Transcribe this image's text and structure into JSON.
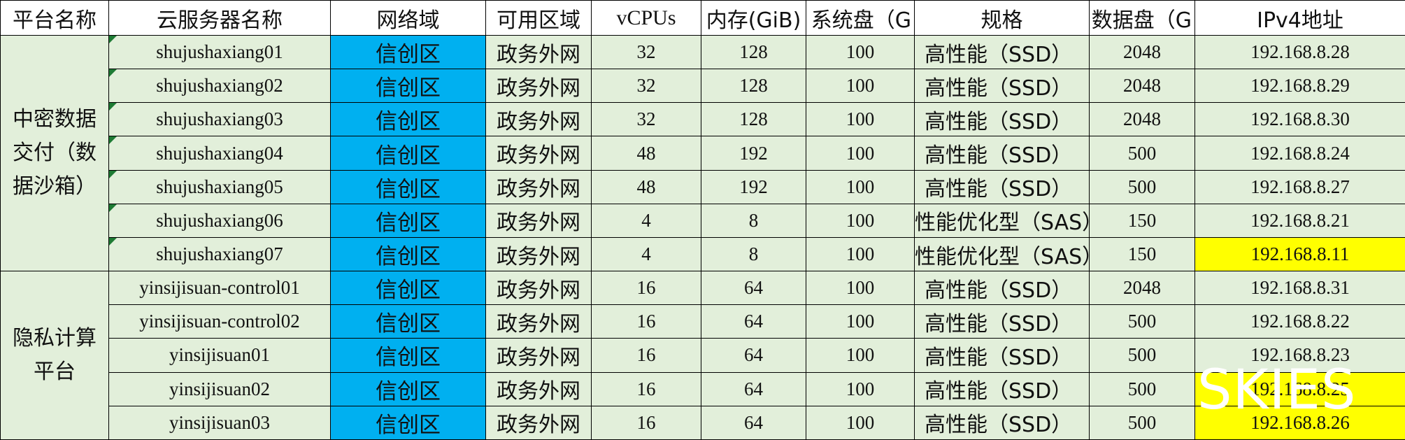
{
  "colors": {
    "grid_fill": "#e2efda",
    "header_fill": "#ffffff",
    "network_fill": "#00b0f0",
    "highlight_fill": "#ffff00",
    "flag_color": "#1e7b34",
    "border": "#000000"
  },
  "headers": [
    "平台名称",
    "云服务器名称",
    "网络域",
    "可用区域",
    "vCPUs",
    "内存(GiB)",
    "系统盘（G",
    "规格",
    "数据盘（G",
    "IPv4地址"
  ],
  "groups": [
    {
      "platform": "中密数据交付（数据沙箱）",
      "rows": [
        {
          "name": "shujushaxiang01",
          "network": "信创区",
          "zone": "政务外网",
          "vcpus": "32",
          "memory": "128",
          "sysdisk": "100",
          "spec": "高性能（SSD）",
          "datadisk": "2048",
          "ip": "192.168.8.28",
          "highlight": false,
          "flag": true
        },
        {
          "name": "shujushaxiang02",
          "network": "信创区",
          "zone": "政务外网",
          "vcpus": "32",
          "memory": "128",
          "sysdisk": "100",
          "spec": "高性能（SSD）",
          "datadisk": "2048",
          "ip": "192.168.8.29",
          "highlight": false,
          "flag": true
        },
        {
          "name": "shujushaxiang03",
          "network": "信创区",
          "zone": "政务外网",
          "vcpus": "32",
          "memory": "128",
          "sysdisk": "100",
          "spec": "高性能（SSD）",
          "datadisk": "2048",
          "ip": "192.168.8.30",
          "highlight": false,
          "flag": true
        },
        {
          "name": "shujushaxiang04",
          "network": "信创区",
          "zone": "政务外网",
          "vcpus": "48",
          "memory": "192",
          "sysdisk": "100",
          "spec": "高性能（SSD）",
          "datadisk": "500",
          "ip": "192.168.8.24",
          "highlight": false,
          "flag": true
        },
        {
          "name": "shujushaxiang05",
          "network": "信创区",
          "zone": "政务外网",
          "vcpus": "48",
          "memory": "192",
          "sysdisk": "100",
          "spec": "高性能（SSD）",
          "datadisk": "500",
          "ip": "192.168.8.27",
          "highlight": false,
          "flag": true
        },
        {
          "name": "shujushaxiang06",
          "network": "信创区",
          "zone": "政务外网",
          "vcpus": "4",
          "memory": "8",
          "sysdisk": "100",
          "spec": "性能优化型（SAS）",
          "datadisk": "150",
          "ip": "192.168.8.21",
          "highlight": false,
          "flag": true
        },
        {
          "name": "shujushaxiang07",
          "network": "信创区",
          "zone": "政务外网",
          "vcpus": "4",
          "memory": "8",
          "sysdisk": "100",
          "spec": "性能优化型（SAS）",
          "datadisk": "150",
          "ip": "192.168.8.11",
          "highlight": true,
          "flag": true
        }
      ]
    },
    {
      "platform": "隐私计算平台",
      "rows": [
        {
          "name": "yinsijisuan-control01",
          "network": "信创区",
          "zone": "政务外网",
          "vcpus": "16",
          "memory": "64",
          "sysdisk": "100",
          "spec": "高性能（SSD）",
          "datadisk": "2048",
          "ip": "192.168.8.31",
          "highlight": false,
          "flag": false
        },
        {
          "name": "yinsijisuan-control02",
          "network": "信创区",
          "zone": "政务外网",
          "vcpus": "16",
          "memory": "64",
          "sysdisk": "100",
          "spec": "高性能（SSD）",
          "datadisk": "500",
          "ip": "192.168.8.22",
          "highlight": false,
          "flag": false
        },
        {
          "name": "yinsijisuan01",
          "network": "信创区",
          "zone": "政务外网",
          "vcpus": "16",
          "memory": "64",
          "sysdisk": "100",
          "spec": "高性能（SSD）",
          "datadisk": "500",
          "ip": "192.168.8.23",
          "highlight": false,
          "flag": false
        },
        {
          "name": "yinsijisuan02",
          "network": "信创区",
          "zone": "政务外网",
          "vcpus": "16",
          "memory": "64",
          "sysdisk": "100",
          "spec": "高性能（SSD）",
          "datadisk": "500",
          "ip": "192.168.8.25",
          "highlight": true,
          "flag": false
        },
        {
          "name": "yinsijisuan03",
          "network": "信创区",
          "zone": "政务外网",
          "vcpus": "16",
          "memory": "64",
          "sysdisk": "100",
          "spec": "高性能（SSD）",
          "datadisk": "500",
          "ip": "192.168.8.26",
          "highlight": true,
          "flag": false
        }
      ]
    }
  ],
  "watermark": "SKIES"
}
